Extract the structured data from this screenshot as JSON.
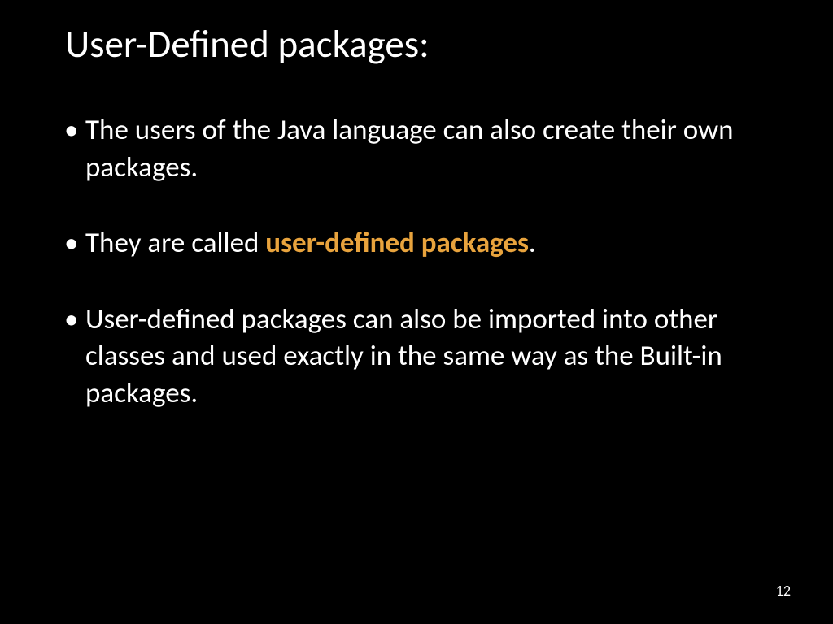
{
  "slide": {
    "title": "User-Defined packages:",
    "bullets": [
      {
        "text_before": "The users of the Java language can also create their own packages.",
        "highlight": "",
        "text_after": ""
      },
      {
        "text_before": "They are called ",
        "highlight": "user-defined packages",
        "text_after": "."
      },
      {
        "text_before": "User-defined packages can also be imported into other classes and used exactly in the same way as the Built-in packages.",
        "highlight": "",
        "text_after": ""
      }
    ],
    "page_number": "12"
  },
  "colors": {
    "background": "#000000",
    "text": "#ffffff",
    "highlight": "#e8a33d"
  }
}
